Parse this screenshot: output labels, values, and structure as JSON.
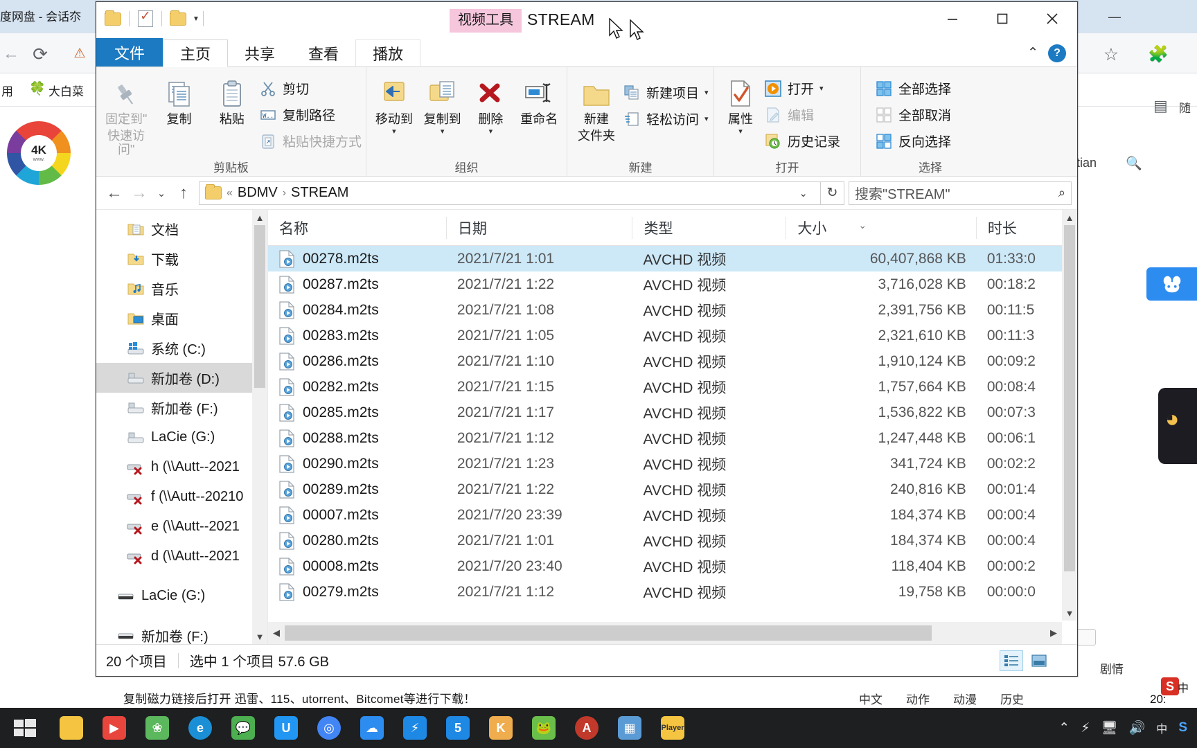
{
  "background": {
    "browser_tab_title": "度网盘 - 会话夵",
    "bookmark_1": "用",
    "bookmark_3": "大白菜",
    "logo_text": "4K",
    "logo_sub": "www.",
    "search_label": "eitian",
    "footer_text": "复制磁力链接后打开 迅雷、115、utorrent、Bitcomet等进行下载！",
    "lower_tabs": [
      "中文",
      "动作",
      "动漫",
      "剧情",
      "历史"
    ],
    "juqing": "剧情",
    "ime_s": "S",
    "ime_lang": "中",
    "clock": "20:"
  },
  "explorer": {
    "title": "STREAM",
    "context_tool_label": "视频工具",
    "quick_access": {
      "new_folder_icon": "folder-icon",
      "properties_icon": "properties-checkmark-icon",
      "customize_icon": "folder-icon",
      "dropdown_icon": "chevron-down-icon"
    },
    "window_buttons": {
      "minimize": "minimize-icon",
      "maximize": "maximize-icon",
      "close": "close-icon"
    },
    "ribbon_tabs": [
      {
        "label": "文件",
        "state": "file"
      },
      {
        "label": "主页",
        "state": "active"
      },
      {
        "label": "共享",
        "state": "normal"
      },
      {
        "label": "查看",
        "state": "normal"
      },
      {
        "label": "播放",
        "state": "contextual"
      }
    ],
    "ribbon_collapse_icon": "chevron-up-icon",
    "help_label": "?",
    "ribbon_groups": [
      {
        "label": "剪贴板",
        "big_buttons": [
          {
            "label": "固定到\"\n快速访问\"",
            "line1": "固定到\"",
            "line2": "快速访问\"",
            "icon": "pin-icon",
            "disabled": true
          },
          {
            "label": "复制",
            "icon": "copy-icon",
            "disabled": false
          },
          {
            "label": "粘贴",
            "icon": "paste-icon",
            "disabled": false
          }
        ],
        "small_buttons": [
          {
            "label": "剪切",
            "icon": "scissors-icon",
            "disabled": false
          },
          {
            "label": "复制路径",
            "icon": "copy-path-icon",
            "disabled": false
          },
          {
            "label": "粘贴快捷方式",
            "icon": "paste-shortcut-icon",
            "disabled": true
          }
        ]
      },
      {
        "label": "组织",
        "big_buttons": [
          {
            "label": "移动到",
            "icon": "move-to-icon",
            "dropdown": true
          },
          {
            "label": "复制到",
            "icon": "copy-to-icon",
            "dropdown": true
          },
          {
            "label": "删除",
            "icon": "delete-x-icon",
            "dropdown": true
          },
          {
            "label": "重命名",
            "icon": "rename-icon",
            "dropdown": false
          }
        ],
        "small_buttons": []
      },
      {
        "label": "新建",
        "big_buttons": [
          {
            "label": "新建\n文件夹",
            "line1": "新建",
            "line2": "文件夹",
            "icon": "new-folder-icon",
            "dropdown": false
          }
        ],
        "small_buttons": [
          {
            "label": "新建项目",
            "icon": "new-item-icon",
            "dropdown": true
          },
          {
            "label": "轻松访问",
            "icon": "easy-access-icon",
            "dropdown": true
          }
        ]
      },
      {
        "label": "打开",
        "big_buttons": [
          {
            "label": "属性",
            "icon": "properties-icon",
            "dropdown": true
          }
        ],
        "small_buttons": [
          {
            "label": "打开",
            "icon": "open-play-icon",
            "dropdown": true,
            "disabled": false
          },
          {
            "label": "编辑",
            "icon": "edit-icon",
            "disabled": true
          },
          {
            "label": "历史记录",
            "icon": "history-icon",
            "disabled": false
          }
        ]
      },
      {
        "label": "选择",
        "big_buttons": [],
        "small_buttons": [
          {
            "label": "全部选择",
            "icon": "select-all-icon",
            "disabled": false
          },
          {
            "label": "全部取消",
            "icon": "select-none-icon",
            "disabled": false
          },
          {
            "label": "反向选择",
            "icon": "invert-selection-icon",
            "disabled": false
          }
        ]
      }
    ],
    "address": {
      "back_icon": "arrow-left-icon",
      "forward_icon": "arrow-right-icon",
      "recent_icon": "chevron-down-icon",
      "up_icon": "arrow-up-icon",
      "folder_icon": "folder-icon",
      "prefix": "«",
      "crumbs": [
        "BDMV",
        "STREAM"
      ],
      "dropdown_icon": "chevron-down-icon",
      "refresh_icon": "refresh-icon",
      "search_placeholder": "搜索\"STREAM\"",
      "search_icon": "search-icon"
    },
    "nav_pane": {
      "items": [
        {
          "label": "文档",
          "icon": "documents-folder-icon",
          "selected": false,
          "indent": 1
        },
        {
          "label": "下载",
          "icon": "downloads-folder-icon",
          "selected": false,
          "indent": 1
        },
        {
          "label": "音乐",
          "icon": "music-folder-icon",
          "selected": false,
          "indent": 1
        },
        {
          "label": "桌面",
          "icon": "desktop-folder-icon",
          "selected": false,
          "indent": 1
        },
        {
          "label": "系统 (C:)",
          "icon": "windows-drive-icon",
          "selected": false,
          "indent": 1
        },
        {
          "label": "新加卷 (D:)",
          "icon": "drive-icon",
          "selected": true,
          "indent": 1
        },
        {
          "label": "新加卷 (F:)",
          "icon": "drive-icon",
          "selected": false,
          "indent": 1
        },
        {
          "label": "LaCie (G:)",
          "icon": "drive-icon",
          "selected": false,
          "indent": 1
        },
        {
          "label": "h (\\\\Autt--2021",
          "icon": "disconnected-network-drive-icon",
          "selected": false,
          "indent": 1
        },
        {
          "label": "f (\\\\Autt--20210",
          "icon": "disconnected-network-drive-icon",
          "selected": false,
          "indent": 1
        },
        {
          "label": "e (\\\\Autt--2021",
          "icon": "disconnected-network-drive-icon",
          "selected": false,
          "indent": 1
        },
        {
          "label": "d (\\\\Autt--2021",
          "icon": "disconnected-network-drive-icon",
          "selected": false,
          "indent": 1
        },
        {
          "label": "LaCie (G:)",
          "icon": "external-drive-icon",
          "selected": false,
          "indent": 0
        },
        {
          "label": "新加卷 (F:)",
          "icon": "external-drive-icon",
          "selected": false,
          "indent": 0
        }
      ]
    },
    "file_list": {
      "columns": [
        "名称",
        "日期",
        "类型",
        "大小",
        "时长"
      ],
      "sort_caret": "chevron-down-icon",
      "rows": [
        {
          "name": "00278.m2ts",
          "date": "2021/7/21 1:01",
          "type": "AVCHD 视频",
          "size": "60,407,868 KB",
          "duration": "01:33:0",
          "selected": true
        },
        {
          "name": "00287.m2ts",
          "date": "2021/7/21 1:22",
          "type": "AVCHD 视频",
          "size": "3,716,028 KB",
          "duration": "00:18:2",
          "selected": false
        },
        {
          "name": "00284.m2ts",
          "date": "2021/7/21 1:08",
          "type": "AVCHD 视频",
          "size": "2,391,756 KB",
          "duration": "00:11:5",
          "selected": false
        },
        {
          "name": "00283.m2ts",
          "date": "2021/7/21 1:05",
          "type": "AVCHD 视频",
          "size": "2,321,610 KB",
          "duration": "00:11:3",
          "selected": false
        },
        {
          "name": "00286.m2ts",
          "date": "2021/7/21 1:10",
          "type": "AVCHD 视频",
          "size": "1,910,124 KB",
          "duration": "00:09:2",
          "selected": false
        },
        {
          "name": "00282.m2ts",
          "date": "2021/7/21 1:15",
          "type": "AVCHD 视频",
          "size": "1,757,664 KB",
          "duration": "00:08:4",
          "selected": false
        },
        {
          "name": "00285.m2ts",
          "date": "2021/7/21 1:17",
          "type": "AVCHD 视频",
          "size": "1,536,822 KB",
          "duration": "00:07:3",
          "selected": false
        },
        {
          "name": "00288.m2ts",
          "date": "2021/7/21 1:12",
          "type": "AVCHD 视频",
          "size": "1,247,448 KB",
          "duration": "00:06:1",
          "selected": false
        },
        {
          "name": "00290.m2ts",
          "date": "2021/7/21 1:23",
          "type": "AVCHD 视频",
          "size": "341,724 KB",
          "duration": "00:02:2",
          "selected": false
        },
        {
          "name": "00289.m2ts",
          "date": "2021/7/21 1:22",
          "type": "AVCHD 视频",
          "size": "240,816 KB",
          "duration": "00:01:4",
          "selected": false
        },
        {
          "name": "00007.m2ts",
          "date": "2021/7/20 23:39",
          "type": "AVCHD 视频",
          "size": "184,374 KB",
          "duration": "00:00:4",
          "selected": false
        },
        {
          "name": "00280.m2ts",
          "date": "2021/7/21 1:01",
          "type": "AVCHD 视频",
          "size": "184,374 KB",
          "duration": "00:00:4",
          "selected": false
        },
        {
          "name": "00008.m2ts",
          "date": "2021/7/20 23:40",
          "type": "AVCHD 视频",
          "size": "118,404 KB",
          "duration": "00:00:2",
          "selected": false
        },
        {
          "name": "00279.m2ts",
          "date": "2021/7/21 1:12",
          "type": "AVCHD 视频",
          "size": "19,758 KB",
          "duration": "00:00:0",
          "selected": false
        }
      ]
    },
    "status_bar": {
      "item_count": "20 个项目",
      "selection": "选中 1 个项目  57.6 GB",
      "view_details_icon": "details-view-icon",
      "view_large_icon": "large-icons-view-icon"
    }
  },
  "taskbar": {
    "start_icon": "windows-start-icon",
    "items": [
      {
        "name": "file-explorer",
        "icon": "folder-icon",
        "color": "#f5c542"
      },
      {
        "name": "media-player",
        "icon": "play-icon",
        "color": "#e8453c"
      },
      {
        "name": "app-clover",
        "icon": "clover-icon",
        "color": "#5cb85c"
      },
      {
        "name": "edge-browser",
        "icon": "e-icon",
        "color": "#1b8fd6"
      },
      {
        "name": "wechat",
        "icon": "wechat-icon",
        "color": "#4caf50"
      },
      {
        "name": "utorrent",
        "icon": "u-icon",
        "color": "#2196f3"
      },
      {
        "name": "chrome",
        "icon": "chrome-icon",
        "color": "#4285f4"
      },
      {
        "name": "baidu-netdisk",
        "icon": "netdisk-icon",
        "color": "#2d8cf0"
      },
      {
        "name": "thunder",
        "icon": "thunder-icon",
        "color": "#1e88e5"
      },
      {
        "name": "app-5",
        "icon": "five-icon",
        "color": "#1e88e5"
      },
      {
        "name": "kugou",
        "icon": "k-icon",
        "color": "#f0ad4e"
      },
      {
        "name": "app-frog",
        "icon": "frog-icon",
        "color": "#6abf4b"
      },
      {
        "name": "app-a",
        "icon": "a-icon",
        "color": "#c0392b"
      },
      {
        "name": "app-blue",
        "icon": "blue-square-icon",
        "color": "#5b9bd5"
      },
      {
        "name": "potplayer",
        "icon": "player-icon",
        "color": "#f5c542"
      }
    ],
    "tray": {
      "expand_icon": "chevron-up-icon",
      "thunder_icon": "thunder-tray-icon",
      "monitor_icon": "monitor-icon",
      "volume_icon": "volume-icon",
      "ime_label": "中",
      "ime_s": "S"
    }
  }
}
